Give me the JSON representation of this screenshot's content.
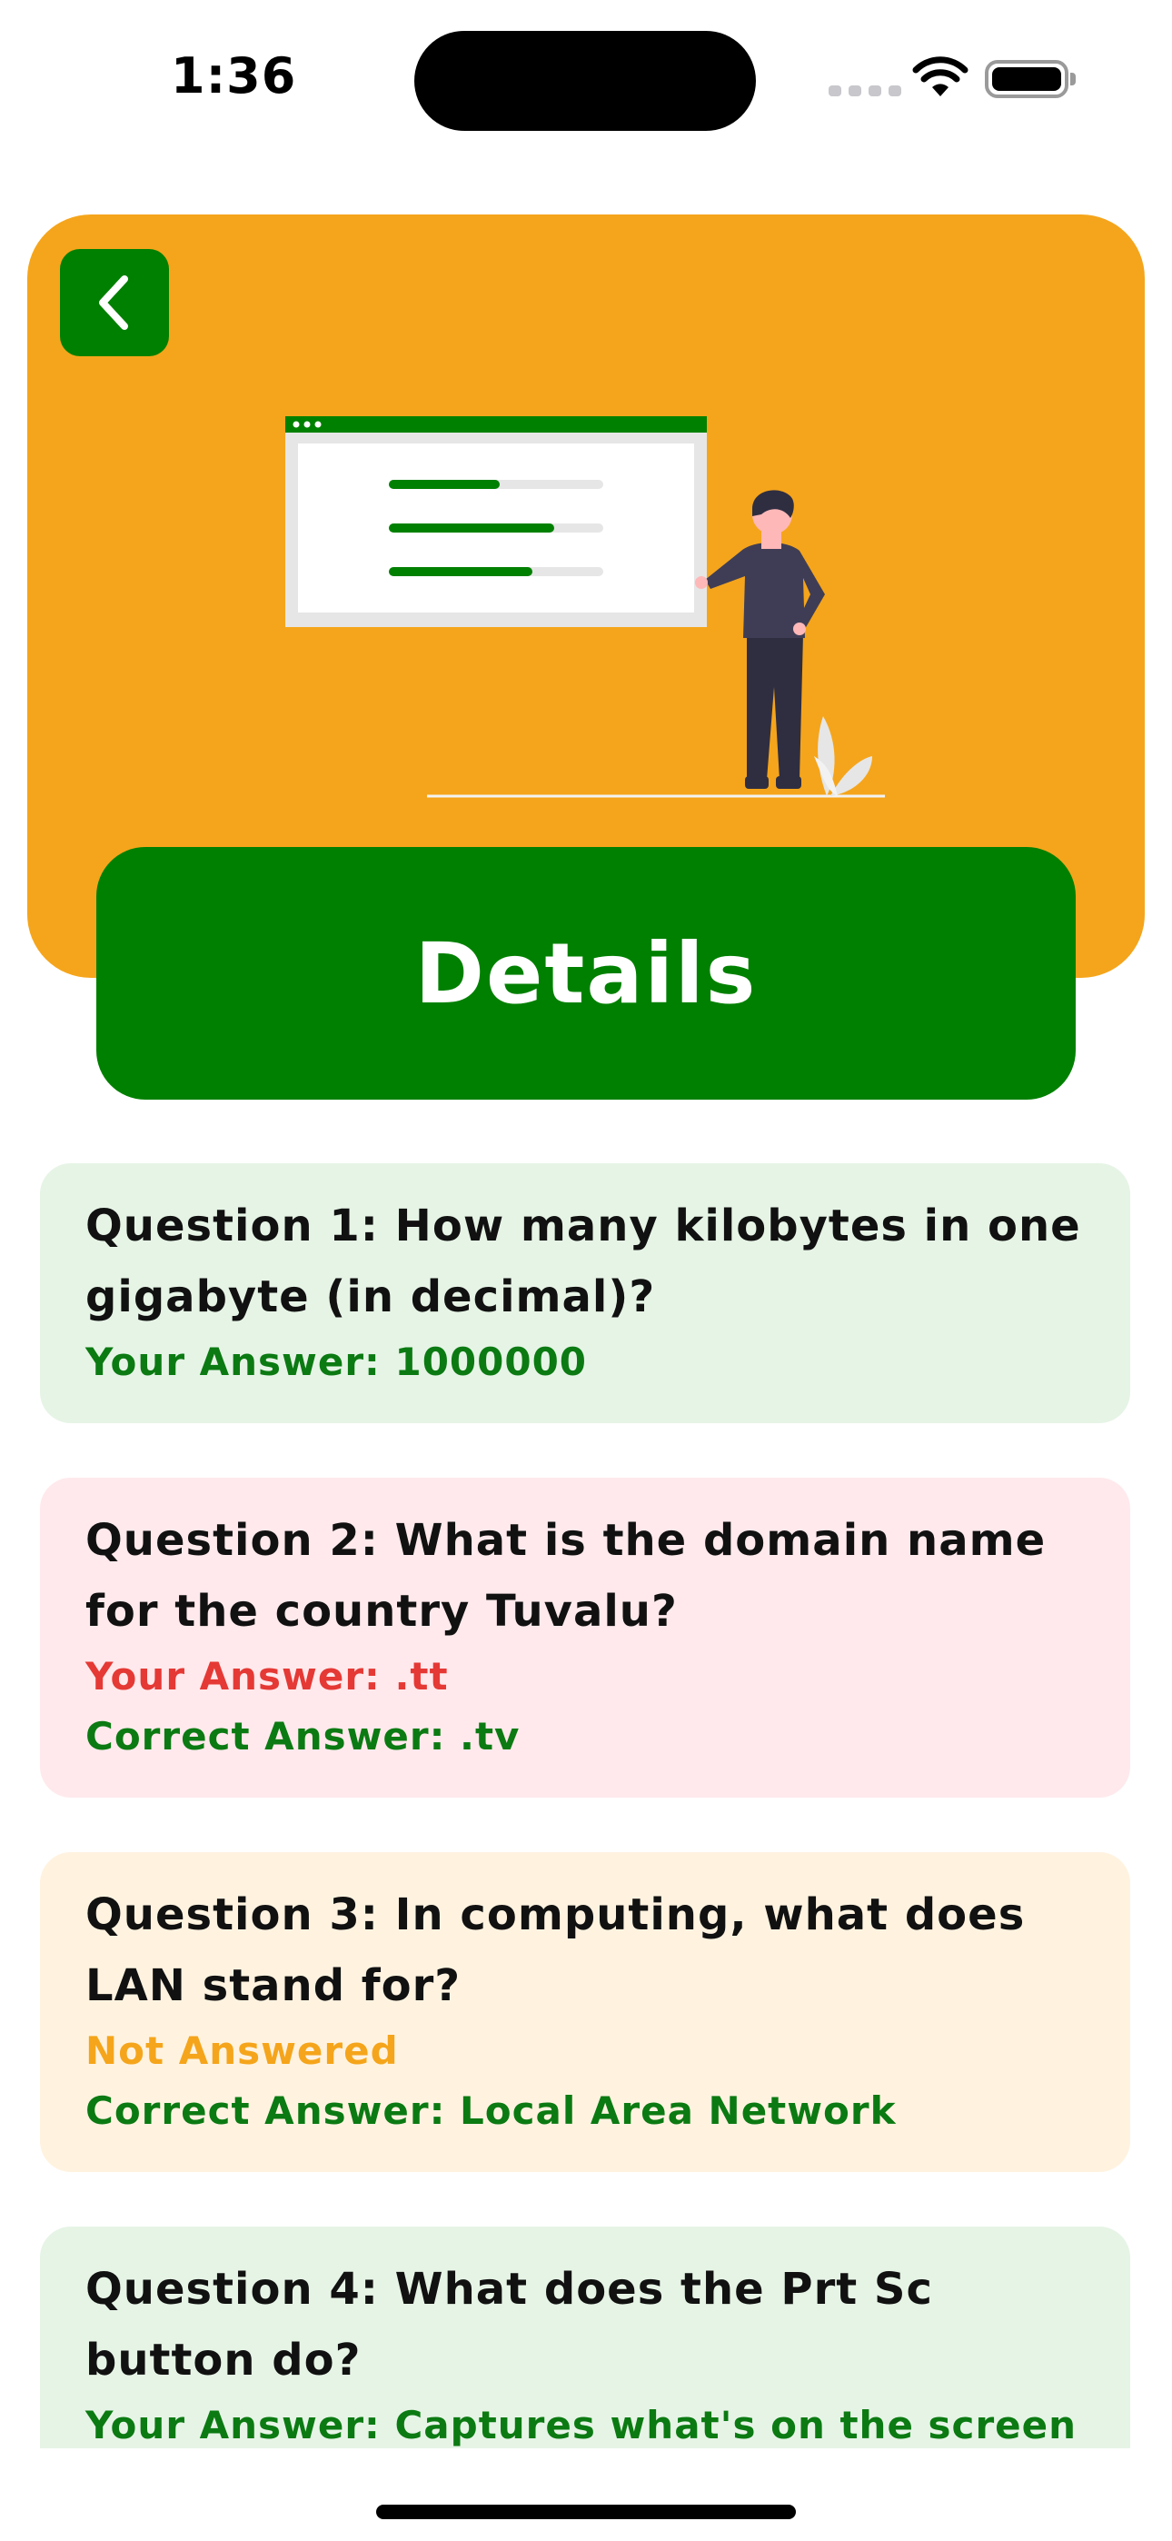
{
  "status_bar": {
    "time": "1:36"
  },
  "header": {
    "back_icon": "chevron-left-icon",
    "title": "Details"
  },
  "colors": {
    "hero": "#f5a51b",
    "primary": "#008000",
    "correct": "#0b7a12",
    "wrong": "#e53935",
    "skipped": "#f5a51b"
  },
  "questions": [
    {
      "question": "Question 1: How many kilobytes in one gigabyte (in decimal)?",
      "your_answer": "Your Answer: 1000000",
      "status": "correct"
    },
    {
      "question": "Question 2: What is the domain name for the country Tuvalu?",
      "your_answer": "Your Answer: .tt",
      "correct_answer": "Correct Answer: .tv",
      "status": "wrong"
    },
    {
      "question": "Question 3: In computing, what does LAN stand for?",
      "not_answered": "Not Answered",
      "correct_answer": "Correct Answer: Local Area Network",
      "status": "skipped"
    },
    {
      "question": "Question 4: What does the Prt Sc button do?",
      "your_answer": "Your Answer: Captures what's on the screen and copies it to your clipboard",
      "status": "correct"
    }
  ]
}
